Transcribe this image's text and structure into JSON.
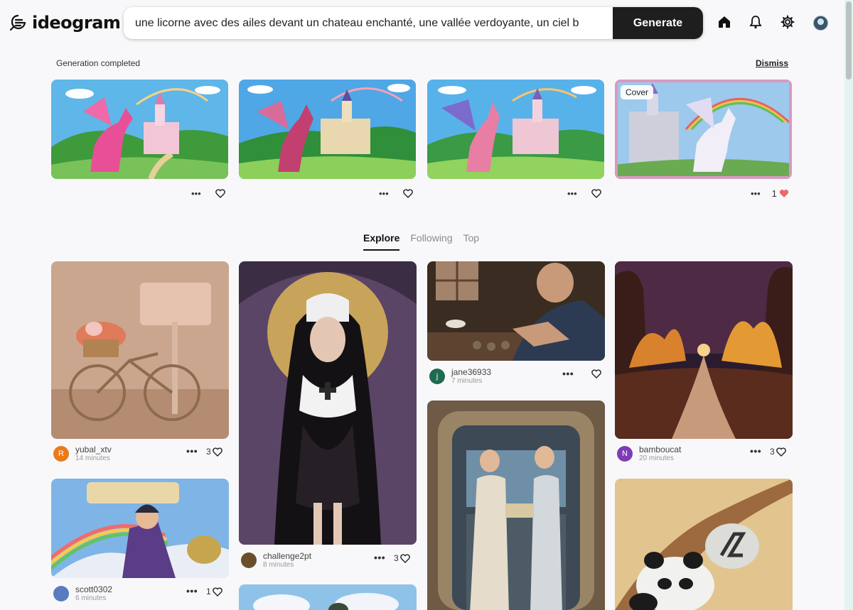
{
  "header": {
    "logo_text": "ideogram",
    "prompt_value": "une licorne avec des ailes devant un chateau enchanté, une vallée verdoyante, un ciel b",
    "generate_label": "Generate"
  },
  "generation": {
    "status": "Generation completed",
    "dismiss_label": "Dismiss",
    "cover_label": "Cover",
    "cards": [
      {
        "likes": ""
      },
      {
        "likes": ""
      },
      {
        "likes": ""
      },
      {
        "likes": "1"
      }
    ]
  },
  "tabs": [
    "Explore",
    "Following",
    "Top"
  ],
  "explore": [
    {
      "user": "yubal_xtv",
      "time": "14 minutes",
      "likes": "3",
      "avatar_letter": "R",
      "avatar_color": "#ea7a1a"
    },
    {
      "user": "challenge2pt",
      "time": "8 minutes",
      "likes": "3",
      "avatar_letter": "",
      "avatar_color": "#6b4f2a"
    },
    {
      "user": "jane36933",
      "time": "7 minutes",
      "likes": "",
      "avatar_letter": "j",
      "avatar_color": "#1e6b4f"
    },
    {
      "user": "bamboucat",
      "time": "20 minutes",
      "likes": "3",
      "avatar_letter": "N",
      "avatar_color": "#7e3bb8"
    },
    {
      "user": "scott0302",
      "time": "6 minutes",
      "likes": "1",
      "avatar_letter": "",
      "avatar_color": "#5a7bbf"
    }
  ],
  "colors": {
    "liked_heart": "#e86a6a",
    "generate_bg": "#1e1e1e",
    "scroll_track": "#e2f4ef"
  }
}
